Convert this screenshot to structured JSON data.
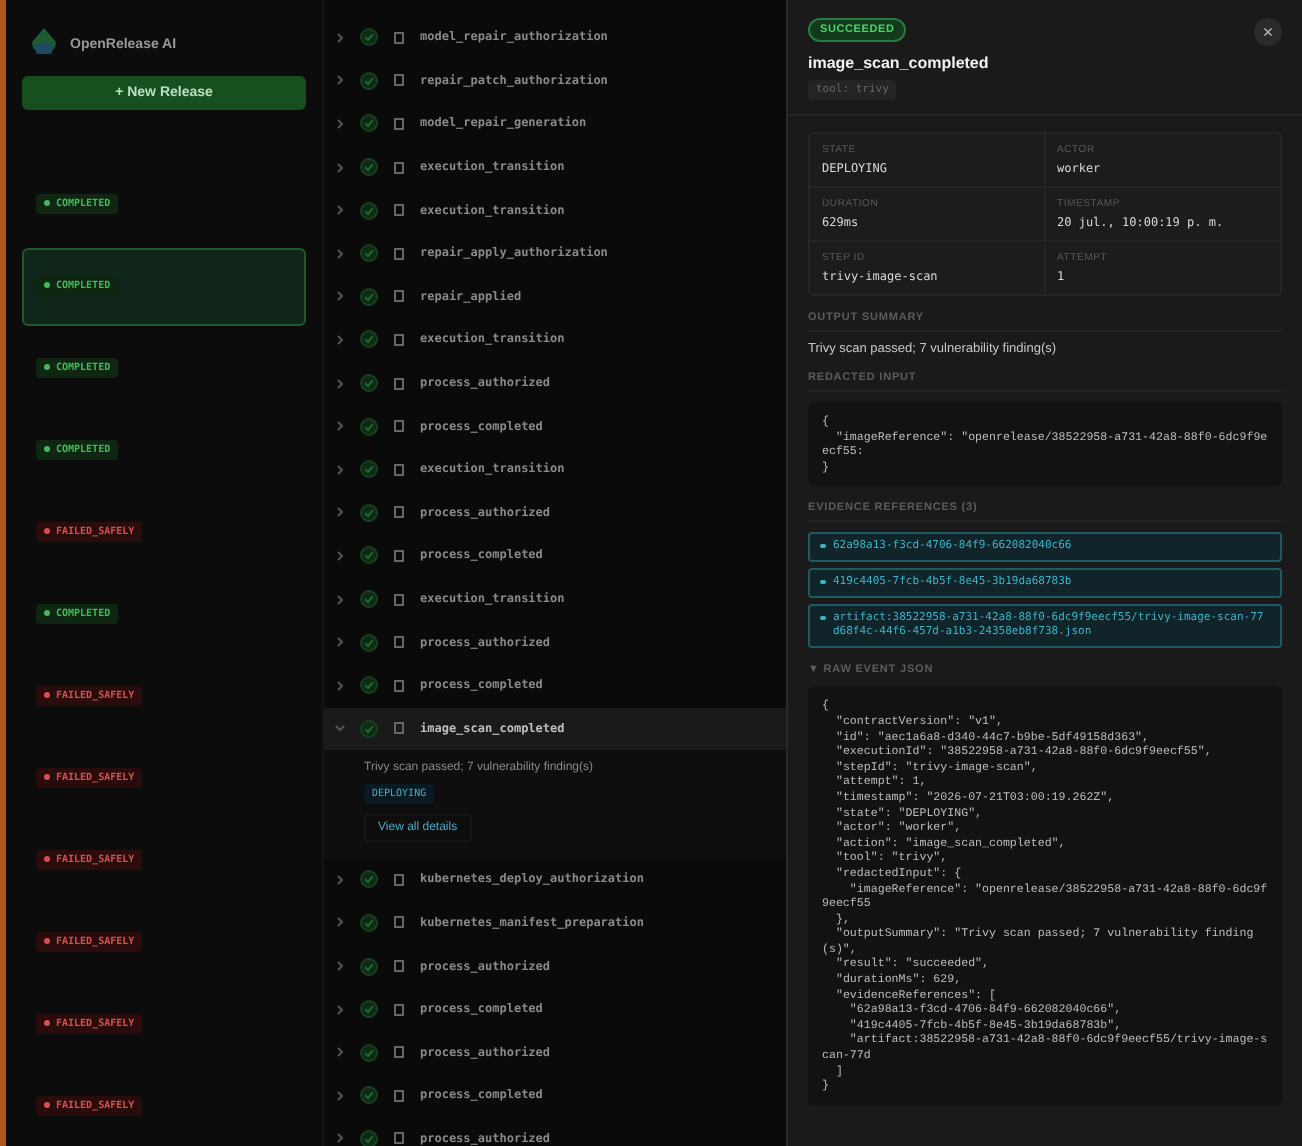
{
  "sidebar": {
    "brand": "OpenRelease AI",
    "new_button": "+ New Release",
    "executions": [
      {
        "kind": "completed",
        "badge": "COMPLETED",
        "selected": false
      },
      {
        "kind": "completed",
        "badge": "COMPLETED",
        "selected": true
      },
      {
        "kind": "completed",
        "badge": "COMPLETED",
        "selected": false
      },
      {
        "kind": "completed",
        "badge": "COMPLETED",
        "selected": false
      },
      {
        "kind": "failed",
        "badge": "FAILED_SAFELY",
        "selected": false
      },
      {
        "kind": "completed",
        "badge": "COMPLETED",
        "selected": false
      },
      {
        "kind": "failed",
        "badge": "FAILED_SAFELY",
        "selected": false
      },
      {
        "kind": "failed",
        "badge": "FAILED_SAFELY",
        "selected": false
      },
      {
        "kind": "failed",
        "badge": "FAILED_SAFELY",
        "selected": false
      },
      {
        "kind": "failed",
        "badge": "FAILED_SAFELY",
        "selected": false
      },
      {
        "kind": "failed",
        "badge": "FAILED_SAFELY",
        "selected": false
      },
      {
        "kind": "failed",
        "badge": "FAILED_SAFELY",
        "selected": false
      }
    ]
  },
  "events": [
    {
      "name": "model_repair_authorization",
      "selected": false
    },
    {
      "name": "repair_patch_authorization",
      "selected": false
    },
    {
      "name": "model_repair_generation",
      "selected": false
    },
    {
      "name": "execution_transition",
      "selected": false
    },
    {
      "name": "execution_transition",
      "selected": false
    },
    {
      "name": "repair_apply_authorization",
      "selected": false
    },
    {
      "name": "repair_applied",
      "selected": false
    },
    {
      "name": "execution_transition",
      "selected": false
    },
    {
      "name": "process_authorized",
      "selected": false
    },
    {
      "name": "process_completed",
      "selected": false
    },
    {
      "name": "execution_transition",
      "selected": false
    },
    {
      "name": "process_authorized",
      "selected": false
    },
    {
      "name": "process_completed",
      "selected": false
    },
    {
      "name": "execution_transition",
      "selected": false
    },
    {
      "name": "process_authorized",
      "selected": false
    },
    {
      "name": "process_completed",
      "selected": false
    },
    {
      "name": "image_scan_completed",
      "selected": true,
      "expanded": true,
      "summary": "Trivy scan passed; 7 vulnerability finding(s)",
      "state_chip": "DEPLOYING",
      "link": "View all details"
    },
    {
      "name": "kubernetes_deploy_authorization",
      "selected": false
    },
    {
      "name": "kubernetes_manifest_preparation",
      "selected": false
    },
    {
      "name": "process_authorized",
      "selected": false
    },
    {
      "name": "process_completed",
      "selected": false
    },
    {
      "name": "process_authorized",
      "selected": false
    },
    {
      "name": "process_completed",
      "selected": false
    },
    {
      "name": "process_authorized",
      "selected": false
    }
  ],
  "drawer": {
    "status": {
      "kind": "succeeded",
      "label": "SUCCEEDED"
    },
    "close": "×",
    "title": "image_scan_completed",
    "tool_chip": "tool: trivy",
    "fields": [
      {
        "label": "STATE",
        "value": "DEPLOYING"
      },
      {
        "label": "ACTOR",
        "value": "worker"
      },
      {
        "label": "DURATION",
        "value": "629ms"
      },
      {
        "label": "TIMESTAMP",
        "value": "20 jul., 10:00:19 p. m."
      },
      {
        "label": "STEP ID",
        "value": "trivy-image-scan"
      },
      {
        "label": "ATTEMPT",
        "value": "1"
      }
    ],
    "output_summary": {
      "heading": "OUTPUT SUMMARY",
      "text": "Trivy scan passed; 7 vulnerability finding(s)"
    },
    "redacted_input": {
      "heading": "REDACTED INPUT",
      "code": "{\n  \"imageReference\": \"openrelease/38522958-a731-42a8-88f0-6dc9f9eecf55:\n}"
    },
    "evidence": {
      "heading": "EVIDENCE REFERENCES (3)",
      "items": [
        "62a98a13-f3cd-4706-84f9-662082040c66",
        "419c4405-7fcb-4b5f-8e45-3b19da68783b",
        "artifact:38522958-a731-42a8-88f0-6dc9f9eecf55/trivy-image-scan-77d68f4c-44f6-457d-a1b3-24358eb8f738.json"
      ]
    },
    "raw": {
      "heading": "▼ RAW EVENT JSON",
      "expanded": true,
      "code": "{\n  \"contractVersion\": \"v1\",\n  \"id\": \"aec1a6a8-d340-44c7-b9be-5df49158d363\",\n  \"executionId\": \"38522958-a731-42a8-88f0-6dc9f9eecf55\",\n  \"stepId\": \"trivy-image-scan\",\n  \"attempt\": 1,\n  \"timestamp\": \"2026-07-21T03:00:19.262Z\",\n  \"state\": \"DEPLOYING\",\n  \"actor\": \"worker\",\n  \"action\": \"image_scan_completed\",\n  \"tool\": \"trivy\",\n  \"redactedInput\": {\n    \"imageReference\": \"openrelease/38522958-a731-42a8-88f0-6dc9f9eecf55\n  },\n  \"outputSummary\": \"Trivy scan passed; 7 vulnerability finding(s)\",\n  \"result\": \"succeeded\",\n  \"durationMs\": 629,\n  \"evidenceReferences\": [\n    \"62a98a13-f3cd-4706-84f9-662082040c66\",\n    \"419c4405-7fcb-4b5f-8e45-3b19da68783b\",\n    \"artifact:38522958-a731-42a8-88f0-6dc9f9eecf55/trivy-image-scan-77d\n  ]\n}"
    }
  }
}
